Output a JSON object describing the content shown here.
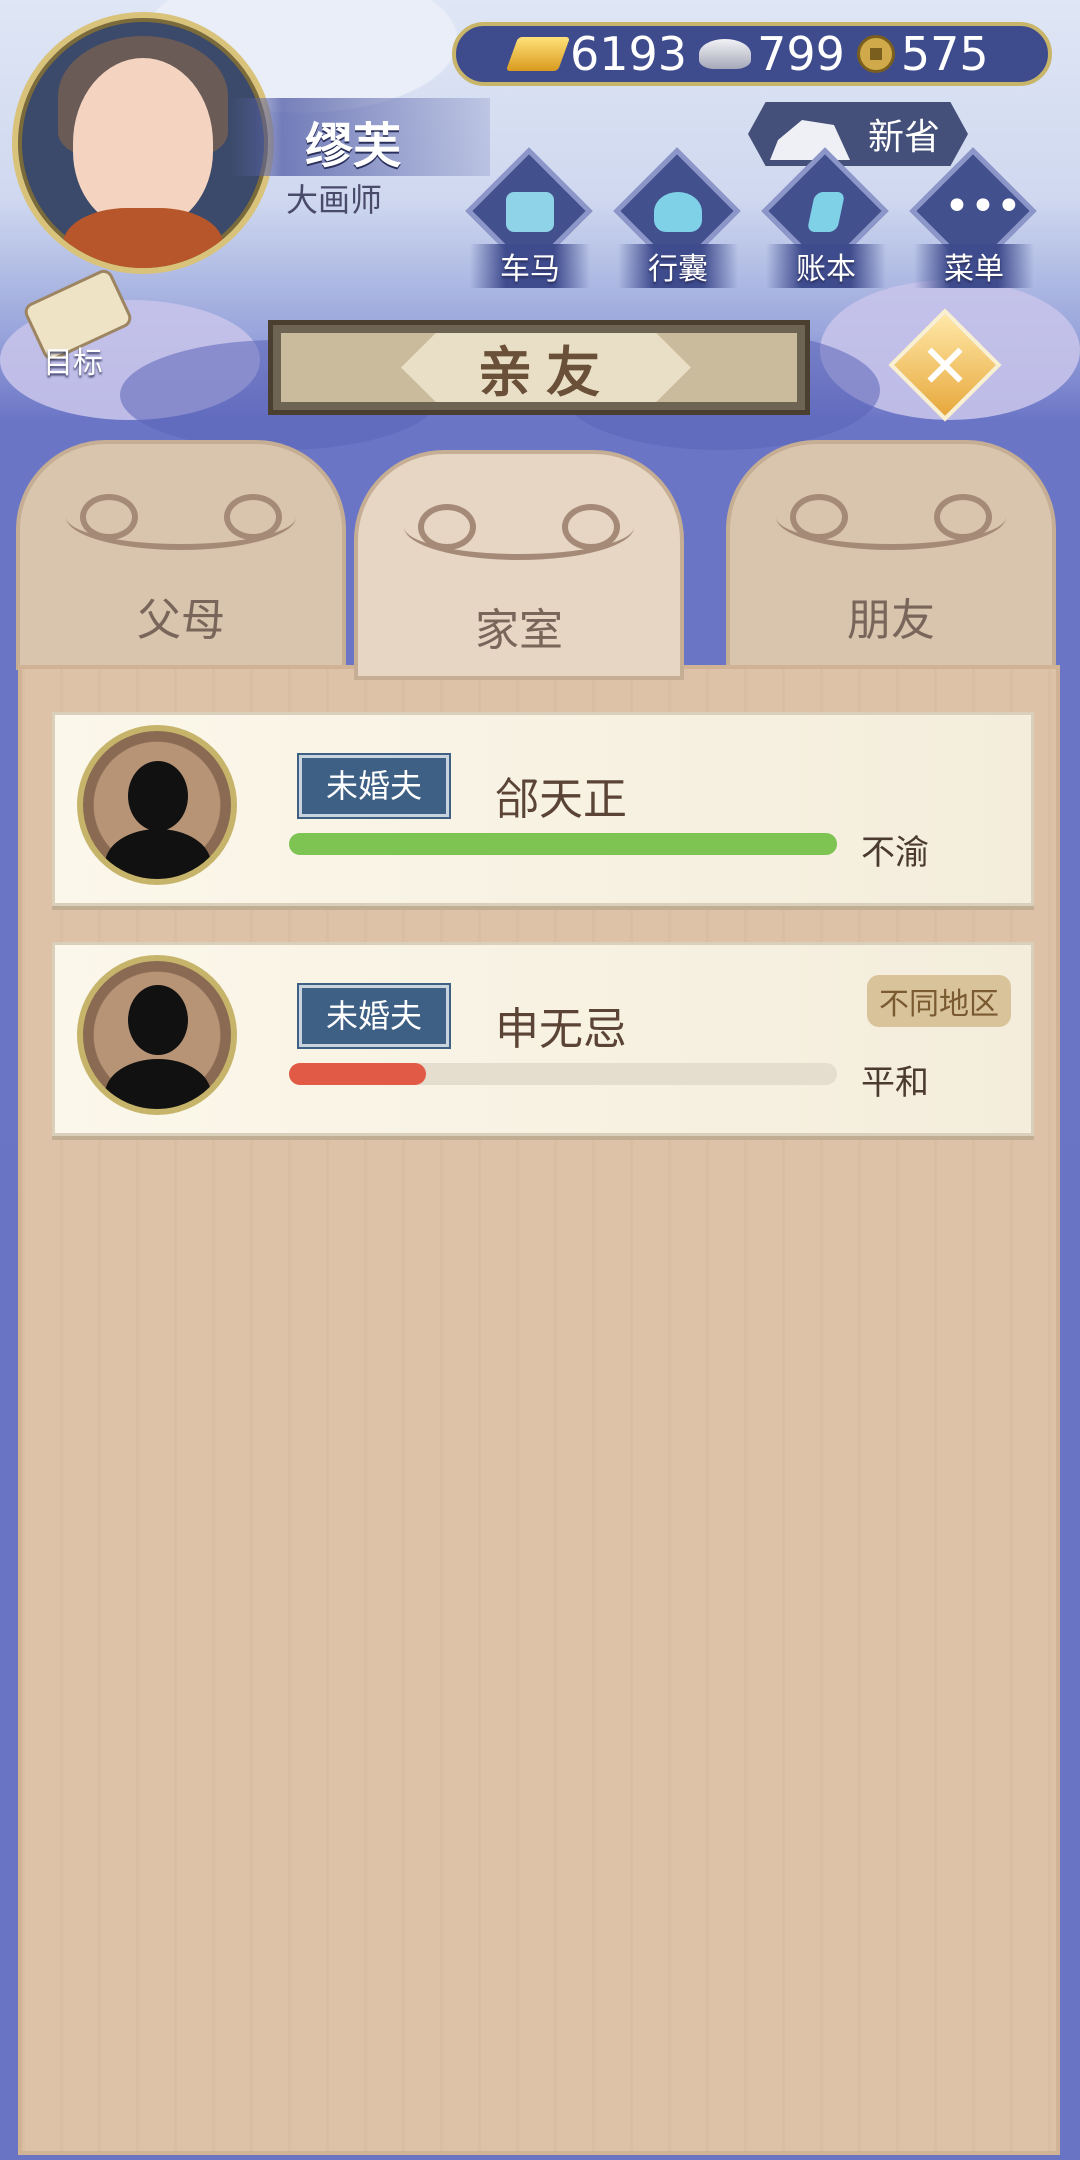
{
  "player": {
    "name": "缪芙",
    "title": "大画师"
  },
  "currency": {
    "gold": "6193",
    "silver": "799",
    "coins": "575"
  },
  "province": "新省",
  "nav": [
    {
      "label": "车马",
      "icon": "carriage-icon"
    },
    {
      "label": "行囊",
      "icon": "bag-icon"
    },
    {
      "label": "账本",
      "icon": "book-icon"
    },
    {
      "label": "菜单",
      "icon": "menu-icon"
    }
  ],
  "goal_label": "目标",
  "panel": {
    "title": "亲友",
    "tabs": [
      {
        "label": "父母",
        "active": false
      },
      {
        "label": "家室",
        "active": true
      },
      {
        "label": "朋友",
        "active": false
      }
    ]
  },
  "relations": [
    {
      "badge": "未婚夫",
      "name": "郃天正",
      "mood": "不渝",
      "region": "",
      "affinity": 1.0,
      "bar_color": "#7dc452"
    },
    {
      "badge": "未婚夫",
      "name": "申无忌",
      "mood": "平和",
      "region": "不同地区",
      "affinity": 0.25,
      "bar_color": "#e05a45"
    }
  ]
}
